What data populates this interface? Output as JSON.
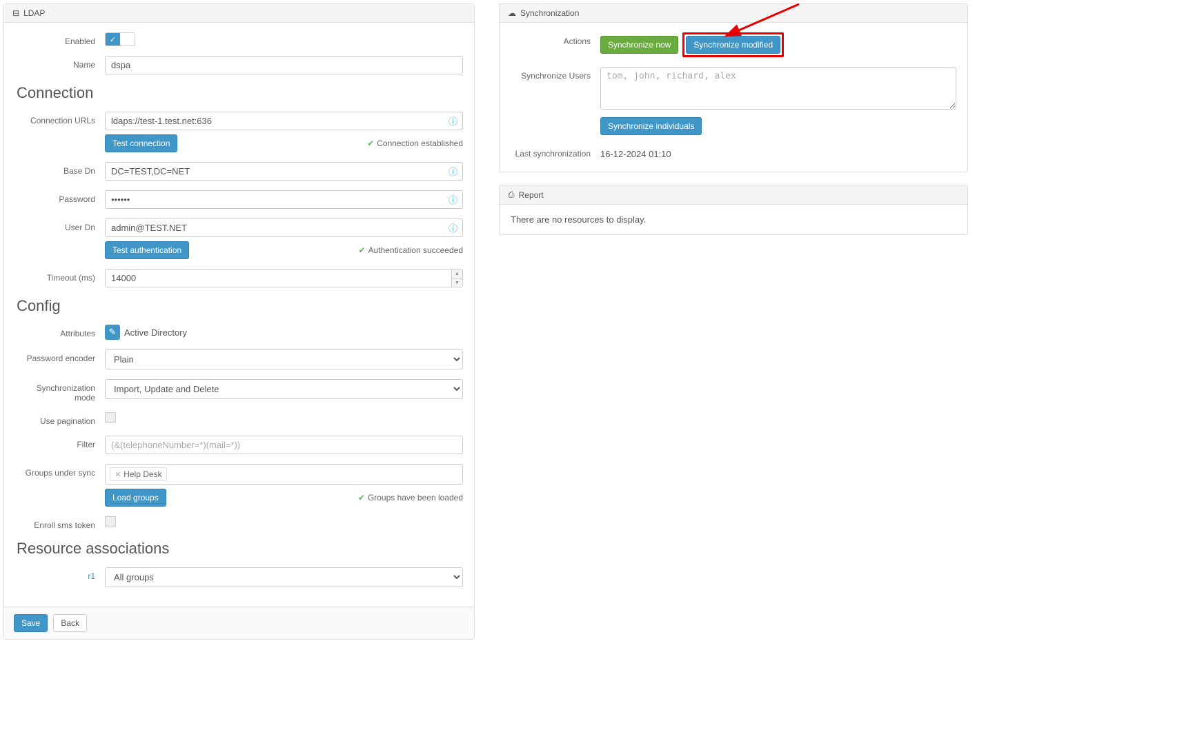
{
  "ldap": {
    "panel_title": "LDAP",
    "enabled_label": "Enabled",
    "name_label": "Name",
    "name_value": "dspa",
    "connection_section": "Connection",
    "connection_urls_label": "Connection URLs",
    "connection_urls_value": "ldaps://test-1.test.net:636",
    "test_connection_btn": "Test connection",
    "connection_status": "Connection established",
    "base_dn_label": "Base Dn",
    "base_dn_value": "DC=TEST,DC=NET",
    "password_label": "Password",
    "password_value": "••••••",
    "user_dn_label": "User Dn",
    "user_dn_value": "admin@TEST.NET",
    "test_auth_btn": "Test authentication",
    "auth_status": "Authentication succeeded",
    "timeout_label": "Timeout (ms)",
    "timeout_value": "14000",
    "config_section": "Config",
    "attributes_label": "Attributes",
    "attributes_value": "Active Directory",
    "pw_encoder_label": "Password encoder",
    "pw_encoder_value": "Plain",
    "sync_mode_label": "Synchronization mode",
    "sync_mode_value": "Import, Update and Delete",
    "use_pagination_label": "Use pagination",
    "filter_label": "Filter",
    "filter_placeholder": "(&(telephoneNumber=*)(mail=*))",
    "groups_sync_label": "Groups under sync",
    "group_tag": "Help Desk",
    "load_groups_btn": "Load groups",
    "groups_status": "Groups have been loaded",
    "enroll_sms_label": "Enroll sms token",
    "resource_assoc_section": "Resource associations",
    "resource_link": "r1",
    "resource_select": "All groups",
    "save_btn": "Save",
    "back_btn": "Back"
  },
  "sync": {
    "panel_title": "Synchronization",
    "actions_label": "Actions",
    "sync_now_btn": "Synchronize now",
    "sync_modified_btn": "Synchronize modified",
    "sync_users_label": "Synchronize Users",
    "sync_users_placeholder": "tom, john, richard, alex",
    "sync_individuals_btn": "Synchronize individuals",
    "last_sync_label": "Last synchronization",
    "last_sync_value": "16-12-2024 01:10"
  },
  "report": {
    "panel_title": "Report",
    "empty_msg": "There are no resources to display."
  }
}
